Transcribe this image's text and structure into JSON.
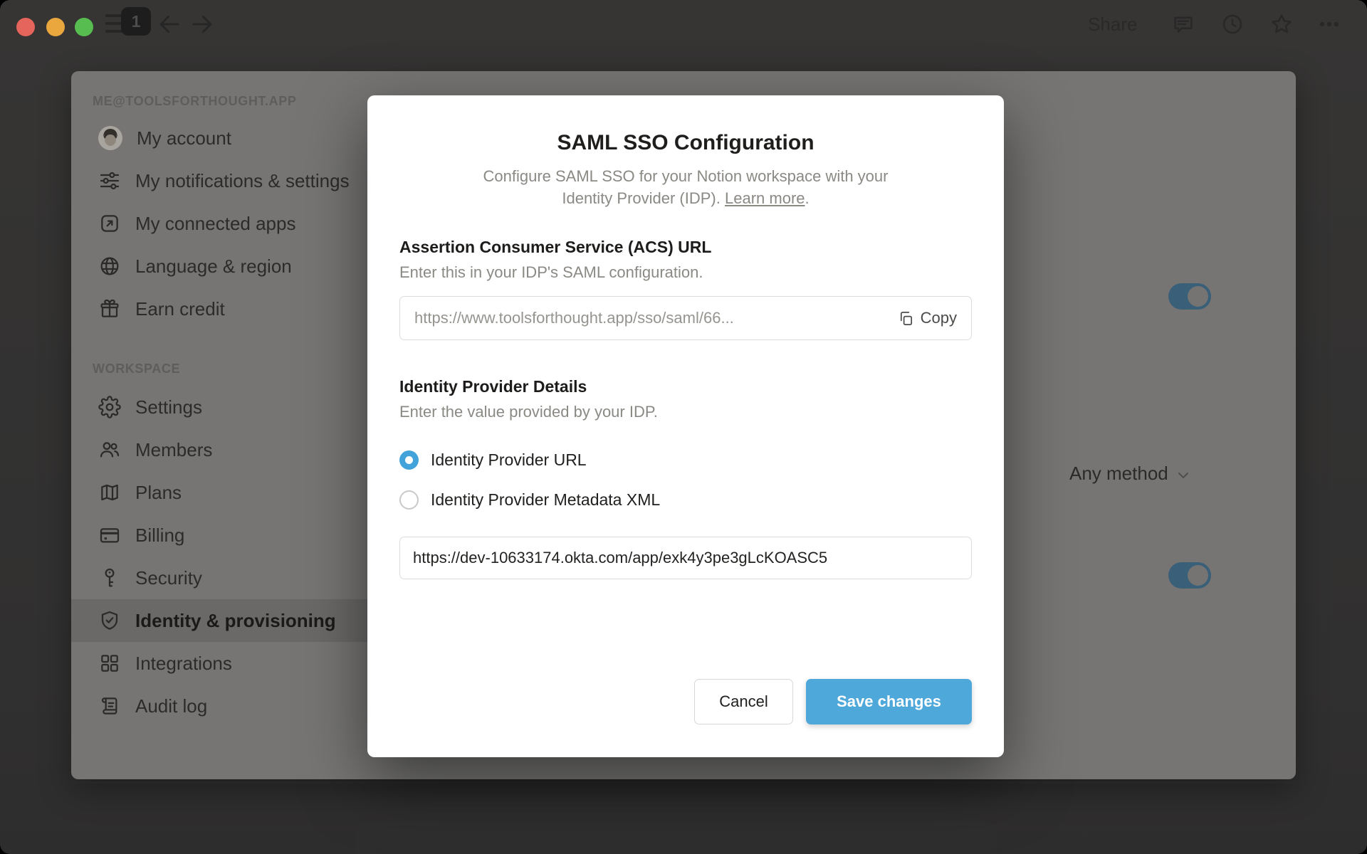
{
  "titlebar": {
    "badge_count": "1",
    "share_label": "Share"
  },
  "sidebar": {
    "account_header": "ME@TOOLSFORTHOUGHT.APP",
    "account_items": [
      {
        "label": "My account",
        "icon": "avatar"
      },
      {
        "label": "My notifications & settings",
        "icon": "sliders-icon"
      },
      {
        "label": "My connected apps",
        "icon": "arrow-up-right-square-icon"
      },
      {
        "label": "Language & region",
        "icon": "globe-icon"
      },
      {
        "label": "Earn credit",
        "icon": "gift-icon"
      }
    ],
    "workspace_header": "WORKSPACE",
    "workspace_items": [
      {
        "label": "Settings",
        "icon": "gear-icon",
        "selected": false
      },
      {
        "label": "Members",
        "icon": "people-icon",
        "selected": false
      },
      {
        "label": "Plans",
        "icon": "map-icon",
        "selected": false
      },
      {
        "label": "Billing",
        "icon": "credit-card-icon",
        "selected": false
      },
      {
        "label": "Security",
        "icon": "key-icon",
        "selected": false
      },
      {
        "label": "Identity & provisioning",
        "icon": "shield-check-icon",
        "selected": true
      },
      {
        "label": "Integrations",
        "icon": "grid-icon",
        "selected": false
      },
      {
        "label": "Audit log",
        "icon": "scroll-icon",
        "selected": false
      }
    ]
  },
  "background_content": {
    "any_method_label": "Any method",
    "toggle_top_state": "on",
    "toggle_bottom_state": "on"
  },
  "modal": {
    "title": "SAML SSO Configuration",
    "subtitle_line1": "Configure SAML SSO for your Notion workspace with your",
    "subtitle_line2_prefix": "Identity Provider (IDP). ",
    "learn_more_label": "Learn more",
    "subtitle_suffix": ".",
    "acs_heading": "Assertion Consumer Service (ACS) URL",
    "acs_description": "Enter this in your IDP's SAML configuration.",
    "acs_value": "https://www.toolsforthought.app/sso/saml/66...",
    "copy_label": "Copy",
    "idp_heading": "Identity Provider Details",
    "idp_description": "Enter the value provided by your IDP.",
    "radio_url_label": "Identity Provider URL",
    "radio_xml_label": "Identity Provider Metadata XML",
    "idp_url_value": "https://dev-10633174.okta.com/app/exk4y3pe3gLcKOASC5",
    "cancel_label": "Cancel",
    "save_label": "Save changes"
  },
  "colors": {
    "save_button_blue": "#4fa8da",
    "radio_selected_blue": "#42a3db",
    "toggle_on_dimmed_blue": "#3a5f78",
    "traffic_red": "#e5645b",
    "traffic_yellow": "#eaa73d",
    "traffic_green": "#58bd51",
    "modal_background": "#ffffff",
    "dimmed_panel_gray": "#767574",
    "window_chrome_dark": "#343434"
  }
}
